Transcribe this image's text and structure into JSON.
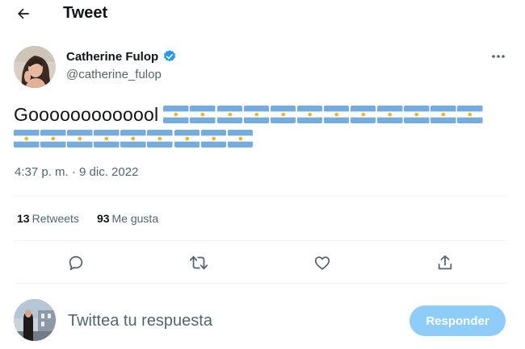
{
  "header": {
    "title": "Tweet"
  },
  "author": {
    "display_name": "Catherine Fulop",
    "handle": "@catherine_fulop",
    "verified": true
  },
  "tweet": {
    "text": "Gooooooooooool",
    "flag_emoji": "🇦🇷",
    "flags_line1": 12,
    "flags_line2": 9,
    "timestamp": "4:37 p. m. · 9 dic. 2022"
  },
  "stats": {
    "retweets_count": "13",
    "retweets_label": "Retweets",
    "likes_count": "93",
    "likes_label": "Me gusta"
  },
  "reply": {
    "placeholder": "Twittea tu respuesta",
    "button_label": "Responder"
  },
  "colors": {
    "verified_blue": "#1d9bf0",
    "button_disabled": "#8ecdf8",
    "secondary_text": "#536471",
    "divider": "#eff3f4",
    "flag_blue": "#74acdf",
    "flag_sun": "#f6b40e"
  },
  "icons": {
    "back": "arrow-left-icon",
    "verified": "verified-badge-icon",
    "more": "more-horizontal-icon",
    "reply": "reply-icon",
    "retweet": "retweet-icon",
    "like": "heart-icon",
    "share": "share-icon"
  }
}
